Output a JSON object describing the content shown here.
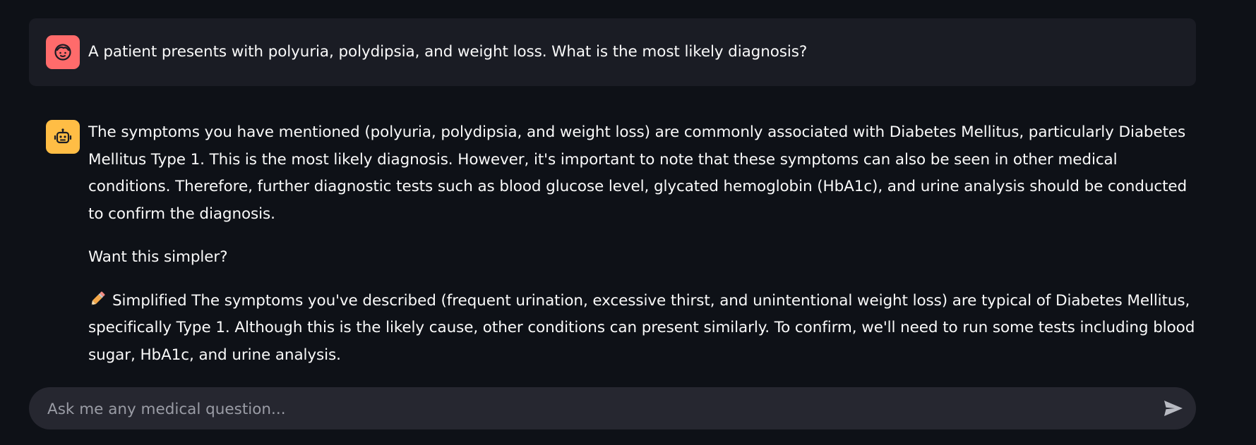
{
  "conversation": {
    "user_message": {
      "avatar_icon": "user-face-icon",
      "avatar_color": "#ff6b6b",
      "text": "A patient presents with polyuria, polydipsia, and weight loss. What is the most likely diagnosis?"
    },
    "assistant_message": {
      "avatar_icon": "robot-icon",
      "avatar_color": "#ffbd45",
      "paragraph_1": "The symptoms you have mentioned (polyuria, polydipsia, and weight loss) are commonly associated with Diabetes Mellitus, particularly Diabetes Mellitus Type 1. This is the most likely diagnosis. However, it's important to note that these symptoms can also be seen in other medical conditions. Therefore, further diagnostic tests such as blood glucose level, glycated hemoglobin (HbA1c), and urine analysis should be conducted to confirm the diagnosis.",
      "paragraph_2": "Want this simpler?",
      "simplified_icon": "pencil-icon",
      "paragraph_3": "Simplified The symptoms you've described (frequent urination, excessive thirst, and unintentional weight loss) are typical of Diabetes Mellitus, specifically Type 1. Although this is the likely cause, other conditions can present similarly. To confirm, we'll need to run some tests including blood sugar, HbA1c, and urine analysis."
    }
  },
  "chat_input": {
    "placeholder": "Ask me any medical question...",
    "value": "",
    "send_icon": "send-icon"
  },
  "colors": {
    "background": "#0e1117",
    "user_bubble": "#1a1c24",
    "input_background": "#262730"
  }
}
